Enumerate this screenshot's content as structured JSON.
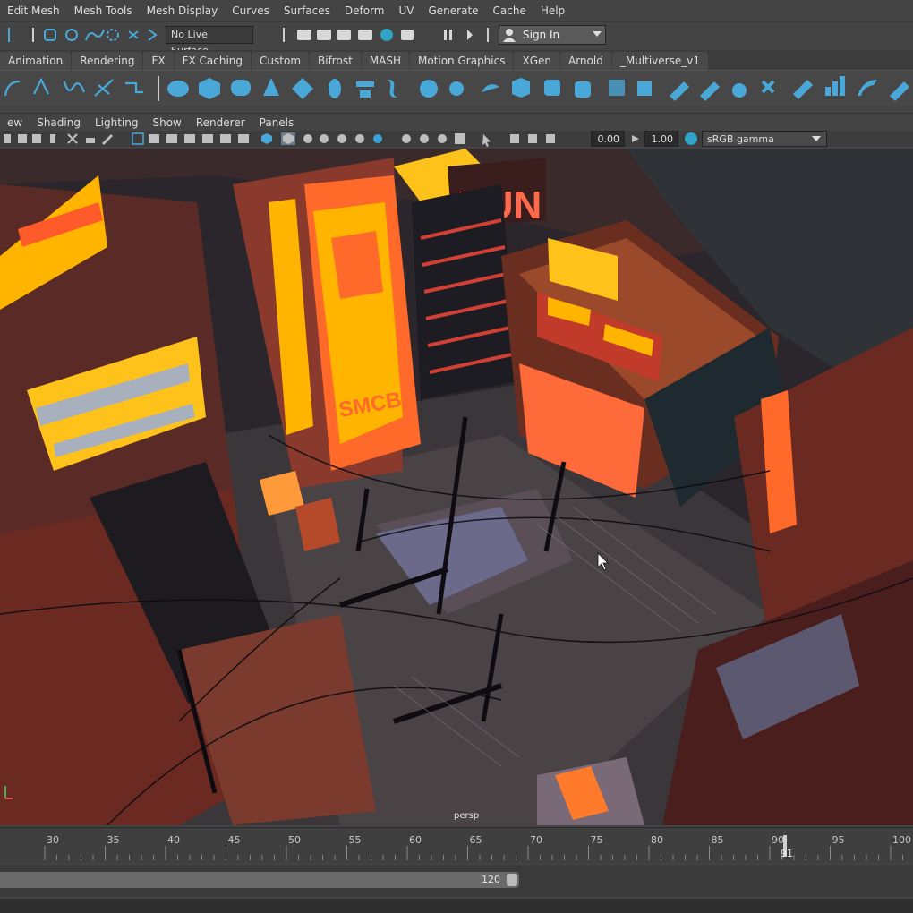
{
  "menus": [
    "Edit Mesh",
    "Mesh Tools",
    "Mesh Display",
    "Curves",
    "Surfaces",
    "Deform",
    "UV",
    "Generate",
    "Cache",
    "Help"
  ],
  "status_line": {
    "live_surface": "No Live Surface",
    "sign_in": "Sign In"
  },
  "shelf_tabs": [
    "Animation",
    "Rendering",
    "FX",
    "FX Caching",
    "Custom",
    "Bifrost",
    "MASH",
    "Motion Graphics",
    "XGen",
    "Arnold",
    "_Multiverse_v1"
  ],
  "panel_menu": [
    "ew",
    "Shading",
    "Lighting",
    "Show",
    "Renderer",
    "Panels"
  ],
  "panel_toolbar": {
    "exposure": "0.00",
    "gamma": "1.00",
    "color_space": "sRGB gamma"
  },
  "viewport": {
    "camera_label": "persp",
    "signs": {
      "run": "RUN",
      "smcb": "SMCB"
    }
  },
  "timeline": {
    "ticks": [
      "30",
      "35",
      "40",
      "45",
      "50",
      "55",
      "60",
      "65",
      "70",
      "75",
      "80",
      "85",
      "90",
      "95",
      "100"
    ],
    "current_frame": "91"
  },
  "range": {
    "end": "120"
  },
  "colors": {
    "accent": "#3aa3d6",
    "neon_orange": "#ff6a2a",
    "neon_yellow": "#ffb400"
  }
}
